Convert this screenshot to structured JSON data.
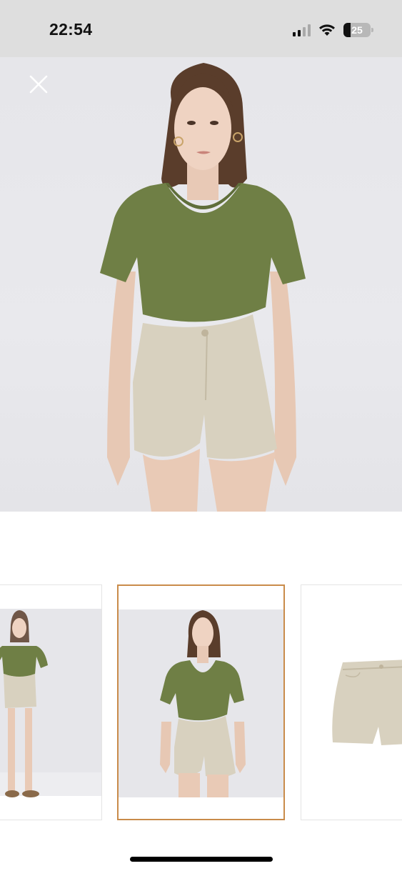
{
  "status_bar": {
    "time": "22:54",
    "battery": "25",
    "icons": [
      "cellular-signal-icon",
      "wifi-icon",
      "battery-icon"
    ]
  },
  "viewer": {
    "close_icon": "close-icon",
    "main_image_description_icon": "product-photo",
    "thumbnails_selected_index": 1
  },
  "colors": {
    "status_bar_bg": "#dedede",
    "photo_bg": "#e7e7eb",
    "tee_green": "#6f7f45",
    "shorts_beige": "#d8d1bf",
    "selected_border": "#c98b4a"
  }
}
